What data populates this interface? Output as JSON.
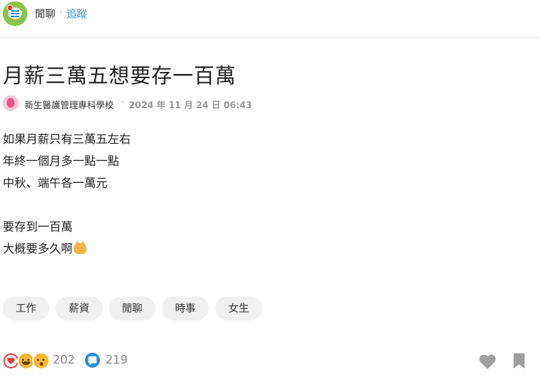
{
  "header": {
    "board_name": "閒聊",
    "separator": "·",
    "follow_label": "追蹤"
  },
  "post": {
    "title": "月薪三萬五想要存一百萬",
    "author_school": "新生醫護管理專科學校",
    "meta_separator": "·",
    "date": "2024 年 11 月 24 日 06:43",
    "body_lines": [
      "如果月薪只有三萬五左右",
      "年終一個月多一點一點",
      "中秋、端午各一萬元",
      "",
      "要存到一百萬",
      "大概要多久啊"
    ],
    "body_emoji": "crying-cat-icon"
  },
  "tags": [
    "工作",
    "薪資",
    "閒聊",
    "時事",
    "女生"
  ],
  "footer": {
    "reaction_count": "202",
    "comment_count": "219",
    "reaction_icons": [
      "heart-icon",
      "laughing-face-icon",
      "surprised-face-icon"
    ]
  },
  "colors": {
    "board_icon_bg": "#8bc34a",
    "follow_link": "#3397cf",
    "heart": "#e53935",
    "comment": "#2e8fd6",
    "tag_bg": "#f0f0f0"
  }
}
